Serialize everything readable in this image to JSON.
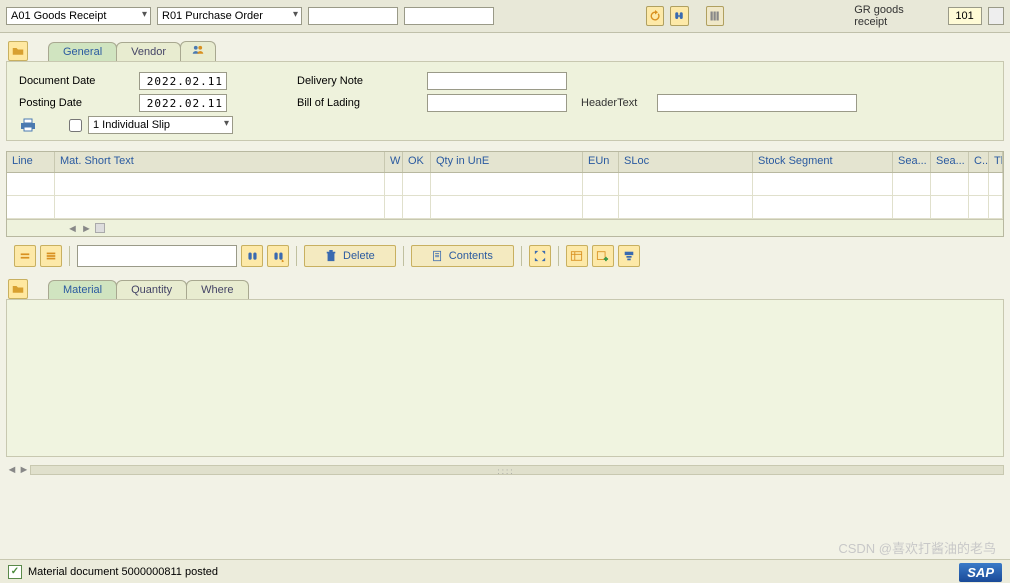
{
  "topbar": {
    "transaction_dd": "A01 Goods Receipt",
    "reference_dd": "R01 Purchase Order",
    "ref_label": "GR goods receipt",
    "ref_code": "101"
  },
  "header_tabs": {
    "general": "General",
    "vendor": "Vendor"
  },
  "header_form": {
    "doc_date_lbl": "Document Date",
    "doc_date": "2022.02.11",
    "post_date_lbl": "Posting Date",
    "post_date": "2022.02.11",
    "del_note_lbl": "Delivery Note",
    "bol_lbl": "Bill of Lading",
    "header_text_lbl": "HeaderText",
    "slip_dd": "1 Individual Slip"
  },
  "grid": {
    "cols": {
      "line": "Line",
      "mat": "Mat. Short Text",
      "w": "W",
      "ok": "OK",
      "qty": "Qty in UnE",
      "eun": "EUn",
      "sloc": "SLoc",
      "sseg": "Stock Segment",
      "sea1": "Sea...",
      "sea2": "Sea...",
      "c": "C...",
      "th": "Th..."
    }
  },
  "actions": {
    "delete": "Delete",
    "contents": "Contents"
  },
  "detail_tabs": {
    "material": "Material",
    "quantity": "Quantity",
    "where": "Where"
  },
  "status": {
    "message": "Material document 5000000811 posted"
  },
  "watermark": "CSDN @喜欢打酱油的老鸟",
  "sap": "SAP"
}
